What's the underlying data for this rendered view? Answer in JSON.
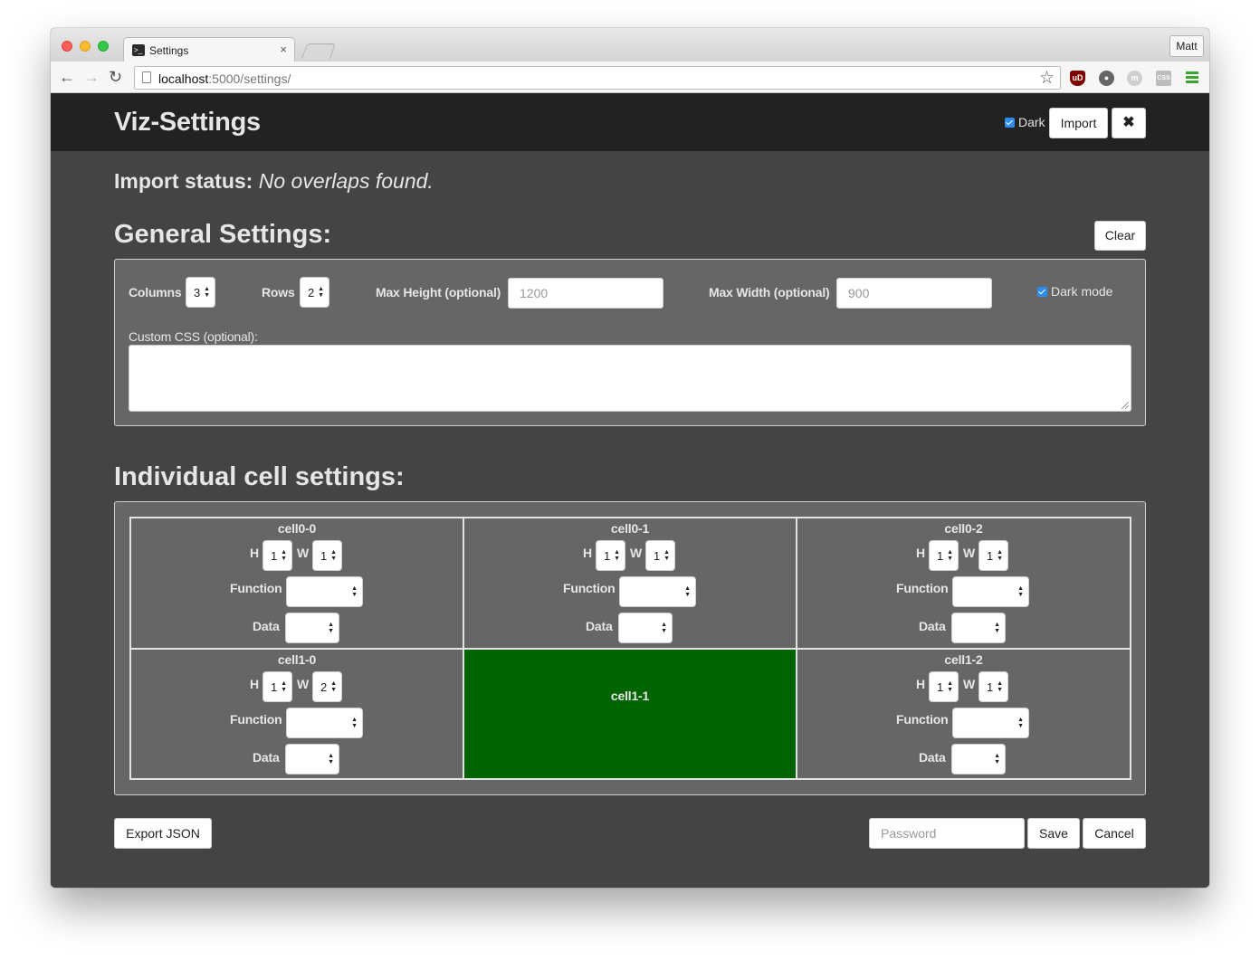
{
  "browser": {
    "tab_title": "Settings",
    "tab_close": "×",
    "profile": "Matt",
    "url_host": "localhost",
    "url_rest": ":5000/settings/",
    "extensions": [
      "ublock-icon",
      "lightbulb-icon",
      "m-icon",
      "css-icon",
      "menu-icon"
    ],
    "ublock_text": "uD",
    "m_text": "m",
    "css_text": "CSS"
  },
  "header": {
    "brand": "Viz-Settings",
    "dark_label": "Dark",
    "dark_checked": true,
    "import_label": "Import",
    "close_label": "✖"
  },
  "import_status": {
    "label": "Import status:",
    "message": "No overlaps found."
  },
  "general": {
    "heading": "General Settings:",
    "clear_label": "Clear",
    "columns_label": "Columns",
    "columns_value": "3",
    "rows_label": "Rows",
    "rows_value": "2",
    "max_height_label": "Max Height (optional)",
    "max_height_placeholder": "1200",
    "max_width_label": "Max Width (optional)",
    "max_width_placeholder": "900",
    "dark_mode_label": "Dark mode",
    "dark_mode_checked": true,
    "custom_css_label": "Custom CSS (optional):",
    "custom_css_value": ""
  },
  "cells": {
    "heading": "Individual cell settings:",
    "h_label": "H",
    "w_label": "W",
    "function_label": "Function",
    "data_label": "Data",
    "items": [
      {
        "name": "cell0-0",
        "h": "1",
        "w": "1",
        "function": "",
        "data": ""
      },
      {
        "name": "cell0-1",
        "h": "1",
        "w": "1",
        "function": "",
        "data": ""
      },
      {
        "name": "cell0-2",
        "h": "1",
        "w": "1",
        "function": "",
        "data": ""
      },
      {
        "name": "cell1-0",
        "h": "1",
        "w": "2",
        "function": "",
        "data": ""
      },
      {
        "name": "cell1-1",
        "covered": true
      },
      {
        "name": "cell1-2",
        "h": "1",
        "w": "1",
        "function": "",
        "data": ""
      }
    ]
  },
  "footer": {
    "export_label": "Export JSON",
    "password_placeholder": "Password",
    "save_label": "Save",
    "cancel_label": "Cancel"
  },
  "colors": {
    "navbar": "#222222",
    "page_bg": "#444444",
    "panel_bg": "#666666",
    "covered_cell": "#006400",
    "checkbox_accent": "#2d8cf0"
  }
}
